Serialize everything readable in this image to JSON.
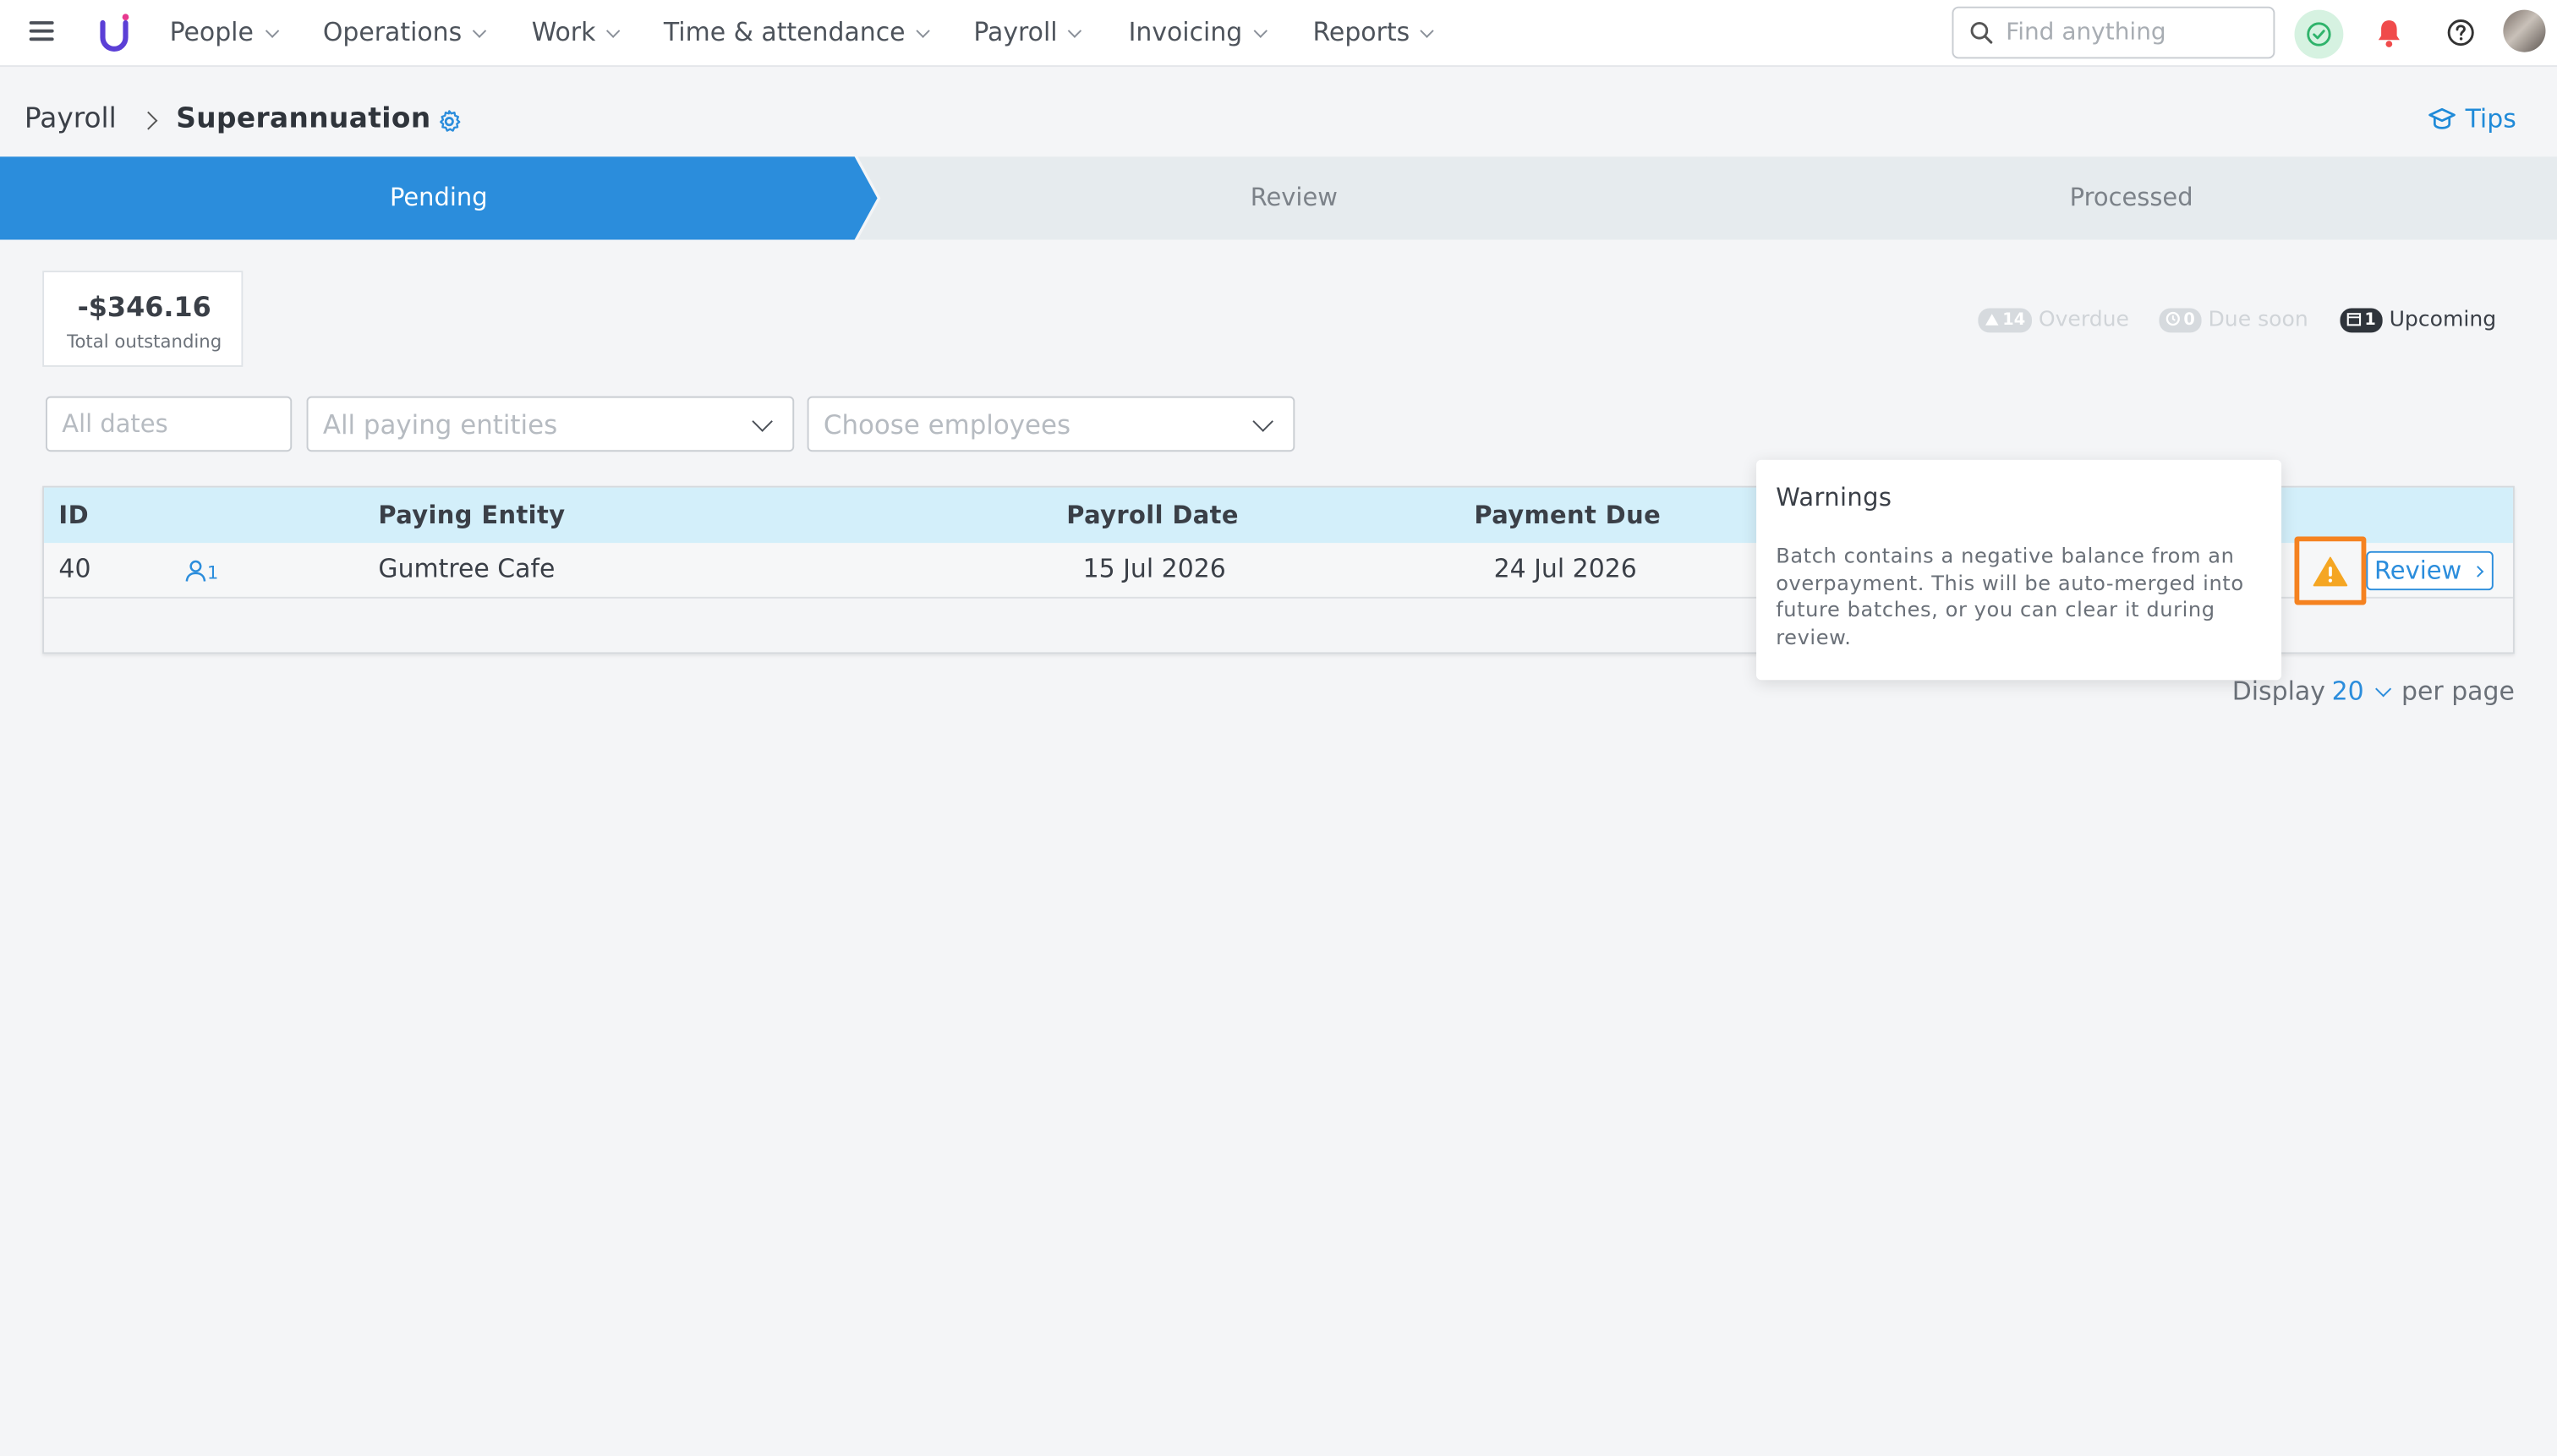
{
  "nav": {
    "items": [
      {
        "label": "People"
      },
      {
        "label": "Operations"
      },
      {
        "label": "Work"
      },
      {
        "label": "Time & attendance"
      },
      {
        "label": "Payroll"
      },
      {
        "label": "Invoicing"
      },
      {
        "label": "Reports"
      }
    ],
    "search_placeholder": "Find anything",
    "icons": [
      "menu-icon",
      "logo-icon",
      "search-icon",
      "check-circle-icon",
      "bell-icon",
      "help-icon",
      "avatar"
    ],
    "accent_color": "#2b8ddc",
    "alert_color": "#f04b4b"
  },
  "breadcrumb": {
    "root": "Payroll",
    "current": "Superannuation"
  },
  "tips_label": "Tips",
  "stepper": {
    "steps": [
      {
        "label": "Pending",
        "active": true
      },
      {
        "label": "Review",
        "active": false
      },
      {
        "label": "Processed",
        "active": false
      }
    ]
  },
  "summary": {
    "amount": "-$346.16",
    "label": "Total outstanding"
  },
  "legend": {
    "overdue_count": "14",
    "overdue_label": "Overdue",
    "soon_count": "0",
    "soon_label": "Due soon",
    "upcoming_count": "1",
    "upcoming_label": "Upcoming"
  },
  "filters": {
    "dates_placeholder": "All dates",
    "entities_placeholder": "All paying entities",
    "employees_placeholder": "Choose employees"
  },
  "table": {
    "headers": {
      "id": "ID",
      "entity": "Paying Entity",
      "payroll_date": "Payroll Date",
      "payment_due": "Payment Due"
    },
    "rows": [
      {
        "id": "40",
        "employees": "1",
        "entity": "Gumtree Cafe",
        "payroll_date": "15 Jul 2026",
        "payment_due": "24 Jul 2026",
        "action": "Review"
      }
    ]
  },
  "tooltip": {
    "title": "Warnings",
    "body": "Batch contains a negative balance from an overpayment. This will be auto-merged into future batches, or you can clear it during review."
  },
  "pagination": {
    "prefix": "Display",
    "value": "20",
    "suffix": "per page"
  },
  "colors": {
    "warning": "#f5a623",
    "warning_highlight": "#f58220",
    "header_row": "#d3effa"
  }
}
